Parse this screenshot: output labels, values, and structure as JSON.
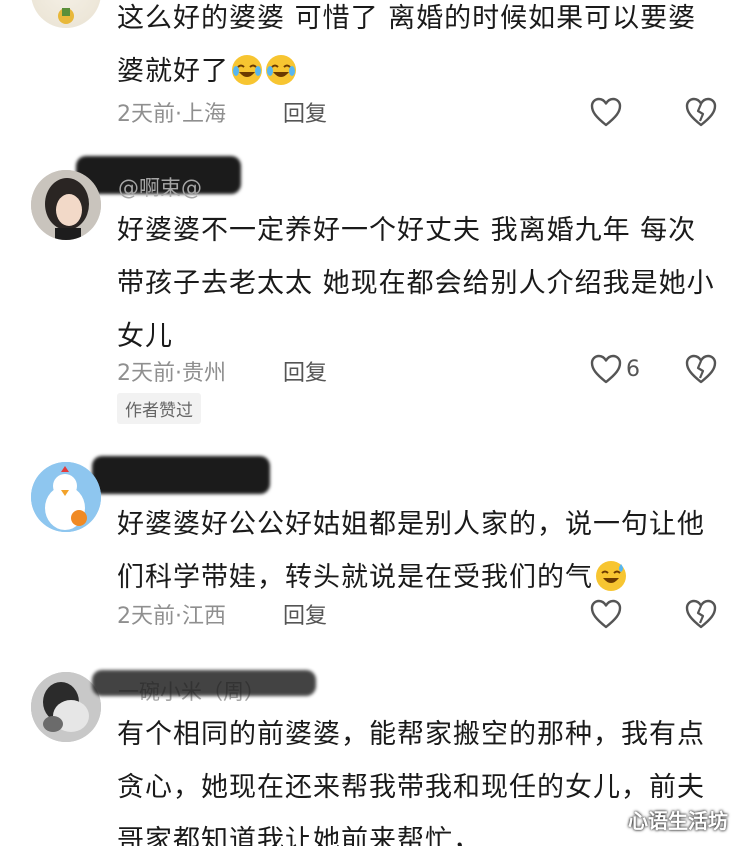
{
  "comments": [
    {
      "username": "",
      "text": "这么好的婆婆 可惜了 离婚的时候如果可以要婆婆就好了",
      "emojis": [
        "laugh-cry-emoji",
        "laugh-cry-emoji"
      ],
      "time": "2天前·上海",
      "reply": "回复",
      "likes": ""
    },
    {
      "username": "@啊束@",
      "text": "好婆婆不一定养好一个好丈夫 我离婚九年 每次带孩子去老太太 她现在都会给别人介绍我是她小女儿",
      "emojis": [],
      "time": "2天前·贵州",
      "reply": "回复",
      "likes": "6",
      "badge": "作者赞过"
    },
    {
      "username": "",
      "text": "好婆婆好公公好姑姐都是别人家的，说一句让他们科学带娃，转头就说是在受我们的气",
      "emojis": [
        "sweat-smile-emoji"
      ],
      "time": "2天前·江西",
      "reply": "回复",
      "likes": ""
    },
    {
      "username": "一碗小米（周）",
      "text": "有个相同的前婆婆，能帮家搬空的那种，我有点贪心，她现在还来帮我带我和现任的女儿，前夫哥家都知道我让她前来帮忙，",
      "emojis": [],
      "time": "",
      "reply": "",
      "likes": ""
    }
  ],
  "watermark": "心语生活坊",
  "colors": {
    "text": "#1a1a1a",
    "meta": "#8f8f8f",
    "redaction": "#1b1b1b",
    "emoji": "#f7c531"
  }
}
